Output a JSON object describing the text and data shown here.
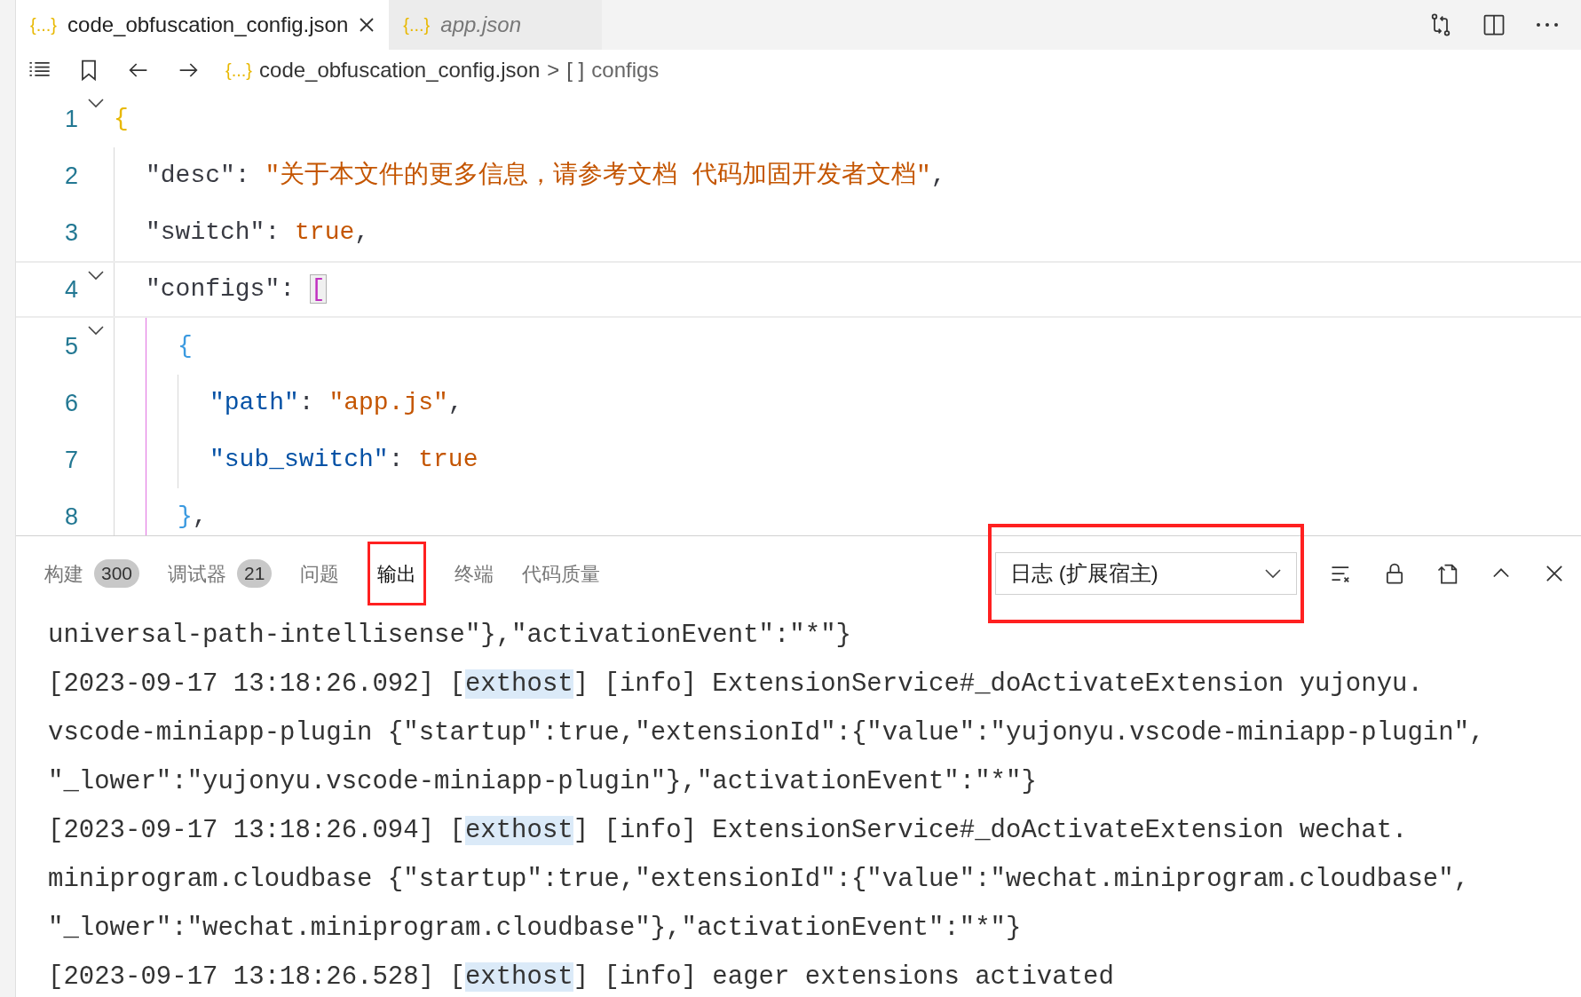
{
  "tabs": [
    {
      "icon": "{...}",
      "label": "code_obfuscation_config.json",
      "selected": true,
      "closable": true
    },
    {
      "icon": "{...}",
      "label": "app.json",
      "selected": false,
      "closable": false
    }
  ],
  "breadcrumb": {
    "icon": "{...}",
    "file": "code_obfuscation_config.json",
    "separator": ">",
    "symbol": "[ ]",
    "section": "configs"
  },
  "editor": {
    "lines": [
      {
        "number": "1",
        "foldable": true,
        "current": false,
        "tokens": [
          {
            "kind": "brace1",
            "text": "{"
          }
        ],
        "children": [
          {
            "number": "2",
            "foldable": false,
            "current": false,
            "tokens": [
              {
                "kind": "key1",
                "text": "\"desc\""
              },
              {
                "kind": "punct",
                "text": ": "
              },
              {
                "kind": "string",
                "text": "\"关于本文件的更多信息，请参考文档 代码加固开发者文档\""
              },
              {
                "kind": "punct",
                "text": ","
              }
            ]
          },
          {
            "number": "3",
            "foldable": false,
            "current": false,
            "tokens": [
              {
                "kind": "key1",
                "text": "\"switch\""
              },
              {
                "kind": "punct",
                "text": ": "
              },
              {
                "kind": "bool",
                "text": "true"
              },
              {
                "kind": "punct",
                "text": ","
              }
            ]
          },
          {
            "number": "4",
            "foldable": true,
            "current": true,
            "tokens": [
              {
                "kind": "key1",
                "text": "\"configs\""
              },
              {
                "kind": "punct",
                "text": ": "
              },
              {
                "kind": "bracket-match",
                "text": "["
              }
            ],
            "children": [
              {
                "number": "5",
                "foldable": true,
                "current": false,
                "tokens": [
                  {
                    "kind": "brace2",
                    "text": "{"
                  }
                ],
                "children": [
                  {
                    "number": "6",
                    "foldable": false,
                    "current": false,
                    "tokens": [
                      {
                        "kind": "key2",
                        "text": "\"path\""
                      },
                      {
                        "kind": "punct",
                        "text": ": "
                      },
                      {
                        "kind": "string",
                        "text": "\"app.js\""
                      },
                      {
                        "kind": "punct",
                        "text": ","
                      }
                    ]
                  },
                  {
                    "number": "7",
                    "foldable": false,
                    "current": false,
                    "tokens": [
                      {
                        "kind": "key2",
                        "text": "\"sub_switch\""
                      },
                      {
                        "kind": "punct",
                        "text": ": "
                      },
                      {
                        "kind": "bool",
                        "text": "true"
                      }
                    ]
                  }
                ]
              },
              {
                "number": "8",
                "foldable": false,
                "current": false,
                "tokens": [
                  {
                    "kind": "brace2",
                    "text": "}"
                  },
                  {
                    "kind": "punct",
                    "text": ","
                  }
                ]
              }
            ]
          }
        ]
      }
    ]
  },
  "panel": {
    "tabs": [
      {
        "label": "构建",
        "badge": "300",
        "selected": false,
        "highlighted": false
      },
      {
        "label": "调试器",
        "badge": "21",
        "selected": false,
        "highlighted": false
      },
      {
        "label": "问题",
        "selected": false,
        "highlighted": false
      },
      {
        "label": "输出",
        "selected": true,
        "highlighted": true
      },
      {
        "label": "终端",
        "selected": false,
        "highlighted": false
      },
      {
        "label": "代码质量",
        "selected": false,
        "highlighted": false
      }
    ],
    "channel": {
      "value": "日志 (扩展宿主)",
      "highlighted": true
    },
    "output": [
      [
        {
          "text": "universal-path-intellisense\"},\"activationEvent\":\"*\"}",
          "highlight": false
        }
      ],
      [
        {
          "text": "[2023-09-17 13:18:26.092] [",
          "highlight": false
        },
        {
          "text": "exthost",
          "highlight": true
        },
        {
          "text": "] [info] ExtensionService#_doActivateExtension yujonyu.",
          "highlight": false
        }
      ],
      [
        {
          "text": "vscode-miniapp-plugin {\"startup\":true,\"extensionId\":{\"value\":\"yujonyu.vscode-miniapp-plugin\",",
          "highlight": false
        }
      ],
      [
        {
          "text": "\"_lower\":\"yujonyu.vscode-miniapp-plugin\"},\"activationEvent\":\"*\"}",
          "highlight": false
        }
      ],
      [
        {
          "text": "[2023-09-17 13:18:26.094] [",
          "highlight": false
        },
        {
          "text": "exthost",
          "highlight": true
        },
        {
          "text": "] [info] ExtensionService#_doActivateExtension wechat.",
          "highlight": false
        }
      ],
      [
        {
          "text": "miniprogram.cloudbase {\"startup\":true,\"extensionId\":{\"value\":\"wechat.miniprogram.cloudbase\",",
          "highlight": false
        }
      ],
      [
        {
          "text": "\"_lower\":\"wechat.miniprogram.cloudbase\"},\"activationEvent\":\"*\"}",
          "highlight": false
        }
      ],
      [
        {
          "text": "[2023-09-17 13:18:26.528] [",
          "highlight": false
        },
        {
          "text": "exthost",
          "highlight": true
        },
        {
          "text": "] [info] eager extensions activated",
          "highlight": false
        }
      ]
    ]
  }
}
